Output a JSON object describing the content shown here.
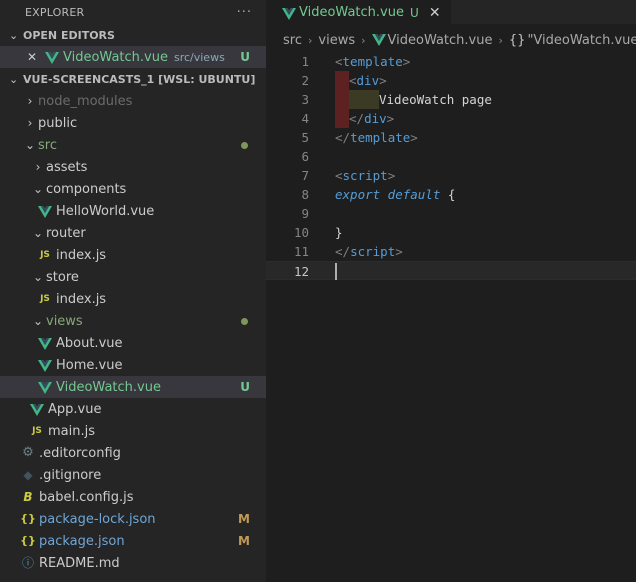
{
  "explorer": {
    "title": "EXPLORER",
    "more": "···",
    "open_editors": {
      "label": "OPEN EDITORS",
      "items": [
        {
          "name": "VideoWatch.vue",
          "path": "src/views",
          "badge": "U"
        }
      ]
    },
    "workspace": {
      "label": "VUE-SCREENCASTS_1 [WSL: UBUNTU]",
      "tree": [
        {
          "name": "node_modules"
        },
        {
          "name": "public"
        },
        {
          "name": "src"
        },
        {
          "name": "assets"
        },
        {
          "name": "components"
        },
        {
          "name": "HelloWorld.vue"
        },
        {
          "name": "router"
        },
        {
          "name": "index.js"
        },
        {
          "name": "store"
        },
        {
          "name": "index.js"
        },
        {
          "name": "views"
        },
        {
          "name": "About.vue"
        },
        {
          "name": "Home.vue"
        },
        {
          "name": "VideoWatch.vue",
          "badge": "U"
        },
        {
          "name": "App.vue"
        },
        {
          "name": "main.js"
        },
        {
          "name": ".editorconfig"
        },
        {
          "name": ".gitignore"
        },
        {
          "name": "babel.config.js"
        },
        {
          "name": "package-lock.json",
          "badge": "M"
        },
        {
          "name": "package.json",
          "badge": "M"
        },
        {
          "name": "README.md"
        }
      ]
    }
  },
  "editor": {
    "tab": {
      "label": "VideoWatch.vue",
      "badge": "U"
    },
    "breadcrumbs": [
      "src",
      "views",
      "VideoWatch.vue",
      "\"VideoWatch.vue\""
    ],
    "lines": [
      {
        "n": "1",
        "tokens": [
          [
            "punc",
            "<"
          ],
          [
            "tag",
            "template"
          ],
          [
            "punc",
            ">"
          ]
        ]
      },
      {
        "n": "2",
        "tokens": [
          [
            "punc",
            "<"
          ],
          [
            "tag",
            "div"
          ],
          [
            "punc",
            ">"
          ]
        ]
      },
      {
        "n": "3",
        "tokens": [
          [
            "text",
            "VideoWatch page"
          ]
        ]
      },
      {
        "n": "4",
        "tokens": [
          [
            "punc",
            "</"
          ],
          [
            "tag",
            "div"
          ],
          [
            "punc",
            ">"
          ]
        ]
      },
      {
        "n": "5",
        "tokens": [
          [
            "punc",
            "</"
          ],
          [
            "tag",
            "template"
          ],
          [
            "punc",
            ">"
          ]
        ]
      },
      {
        "n": "6",
        "tokens": []
      },
      {
        "n": "7",
        "tokens": [
          [
            "punc",
            "<"
          ],
          [
            "tag",
            "script"
          ],
          [
            "punc",
            ">"
          ]
        ]
      },
      {
        "n": "8",
        "tokens": [
          [
            "kw",
            "export default"
          ],
          [
            "brace",
            " {"
          ]
        ]
      },
      {
        "n": "9",
        "tokens": []
      },
      {
        "n": "10",
        "tokens": [
          [
            "brace",
            "}"
          ]
        ]
      },
      {
        "n": "11",
        "tokens": [
          [
            "punc",
            "</"
          ],
          [
            "tag",
            "script"
          ],
          [
            "punc",
            ">"
          ]
        ]
      },
      {
        "n": "12",
        "tokens": []
      }
    ]
  },
  "colors": {
    "untracked": "#73c991",
    "modified": "#6fa6d6",
    "badge_modified": "#c09a58",
    "vue_icon": "#41b883"
  }
}
